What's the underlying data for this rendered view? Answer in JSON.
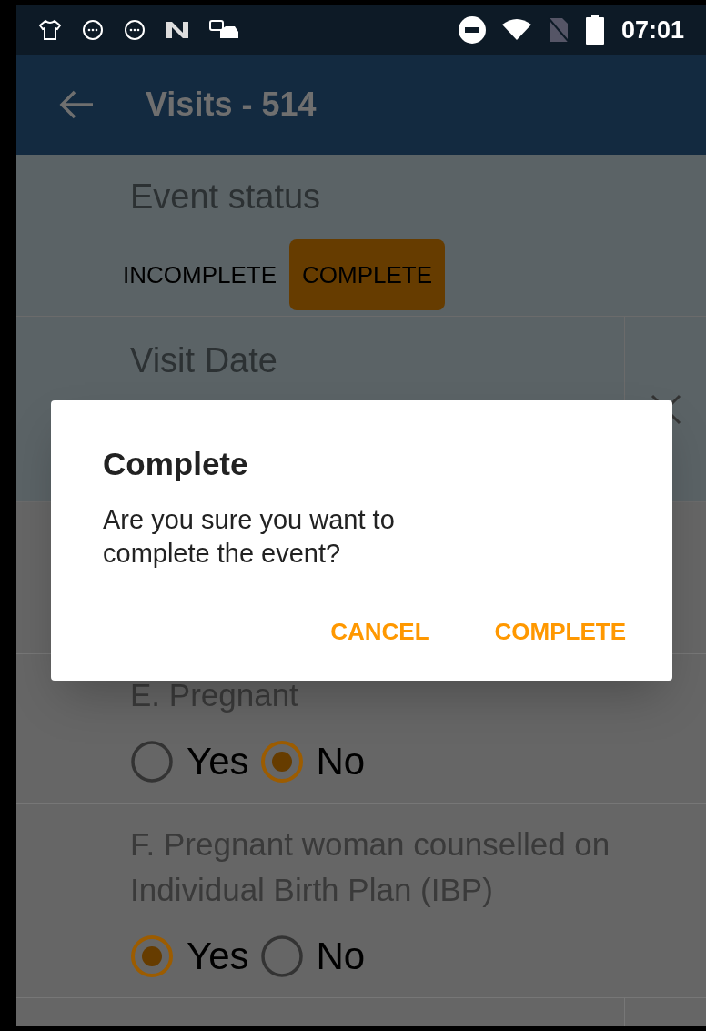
{
  "status_bar": {
    "time": "07:01"
  },
  "app_bar": {
    "title": "Visits - 514"
  },
  "event_status": {
    "label": "Event status",
    "options": [
      {
        "label": "INCOMPLETE",
        "selected": false
      },
      {
        "label": "COMPLETE",
        "selected": true
      }
    ]
  },
  "visit_date": {
    "label": "Visit Date"
  },
  "questions": [
    {
      "label": "E. Pregnant",
      "options": [
        {
          "label": "Yes",
          "selected": false
        },
        {
          "label": "No",
          "selected": true
        }
      ]
    },
    {
      "label": "F. Pregnant woman counselled on Individual Birth Plan (IBP)",
      "options": [
        {
          "label": "Yes",
          "selected": true
        },
        {
          "label": "No",
          "selected": false
        }
      ]
    }
  ],
  "dialog": {
    "title": "Complete",
    "message": "Are you sure you want to complete the event?",
    "buttons": [
      "CANCEL",
      "COMPLETE"
    ]
  }
}
